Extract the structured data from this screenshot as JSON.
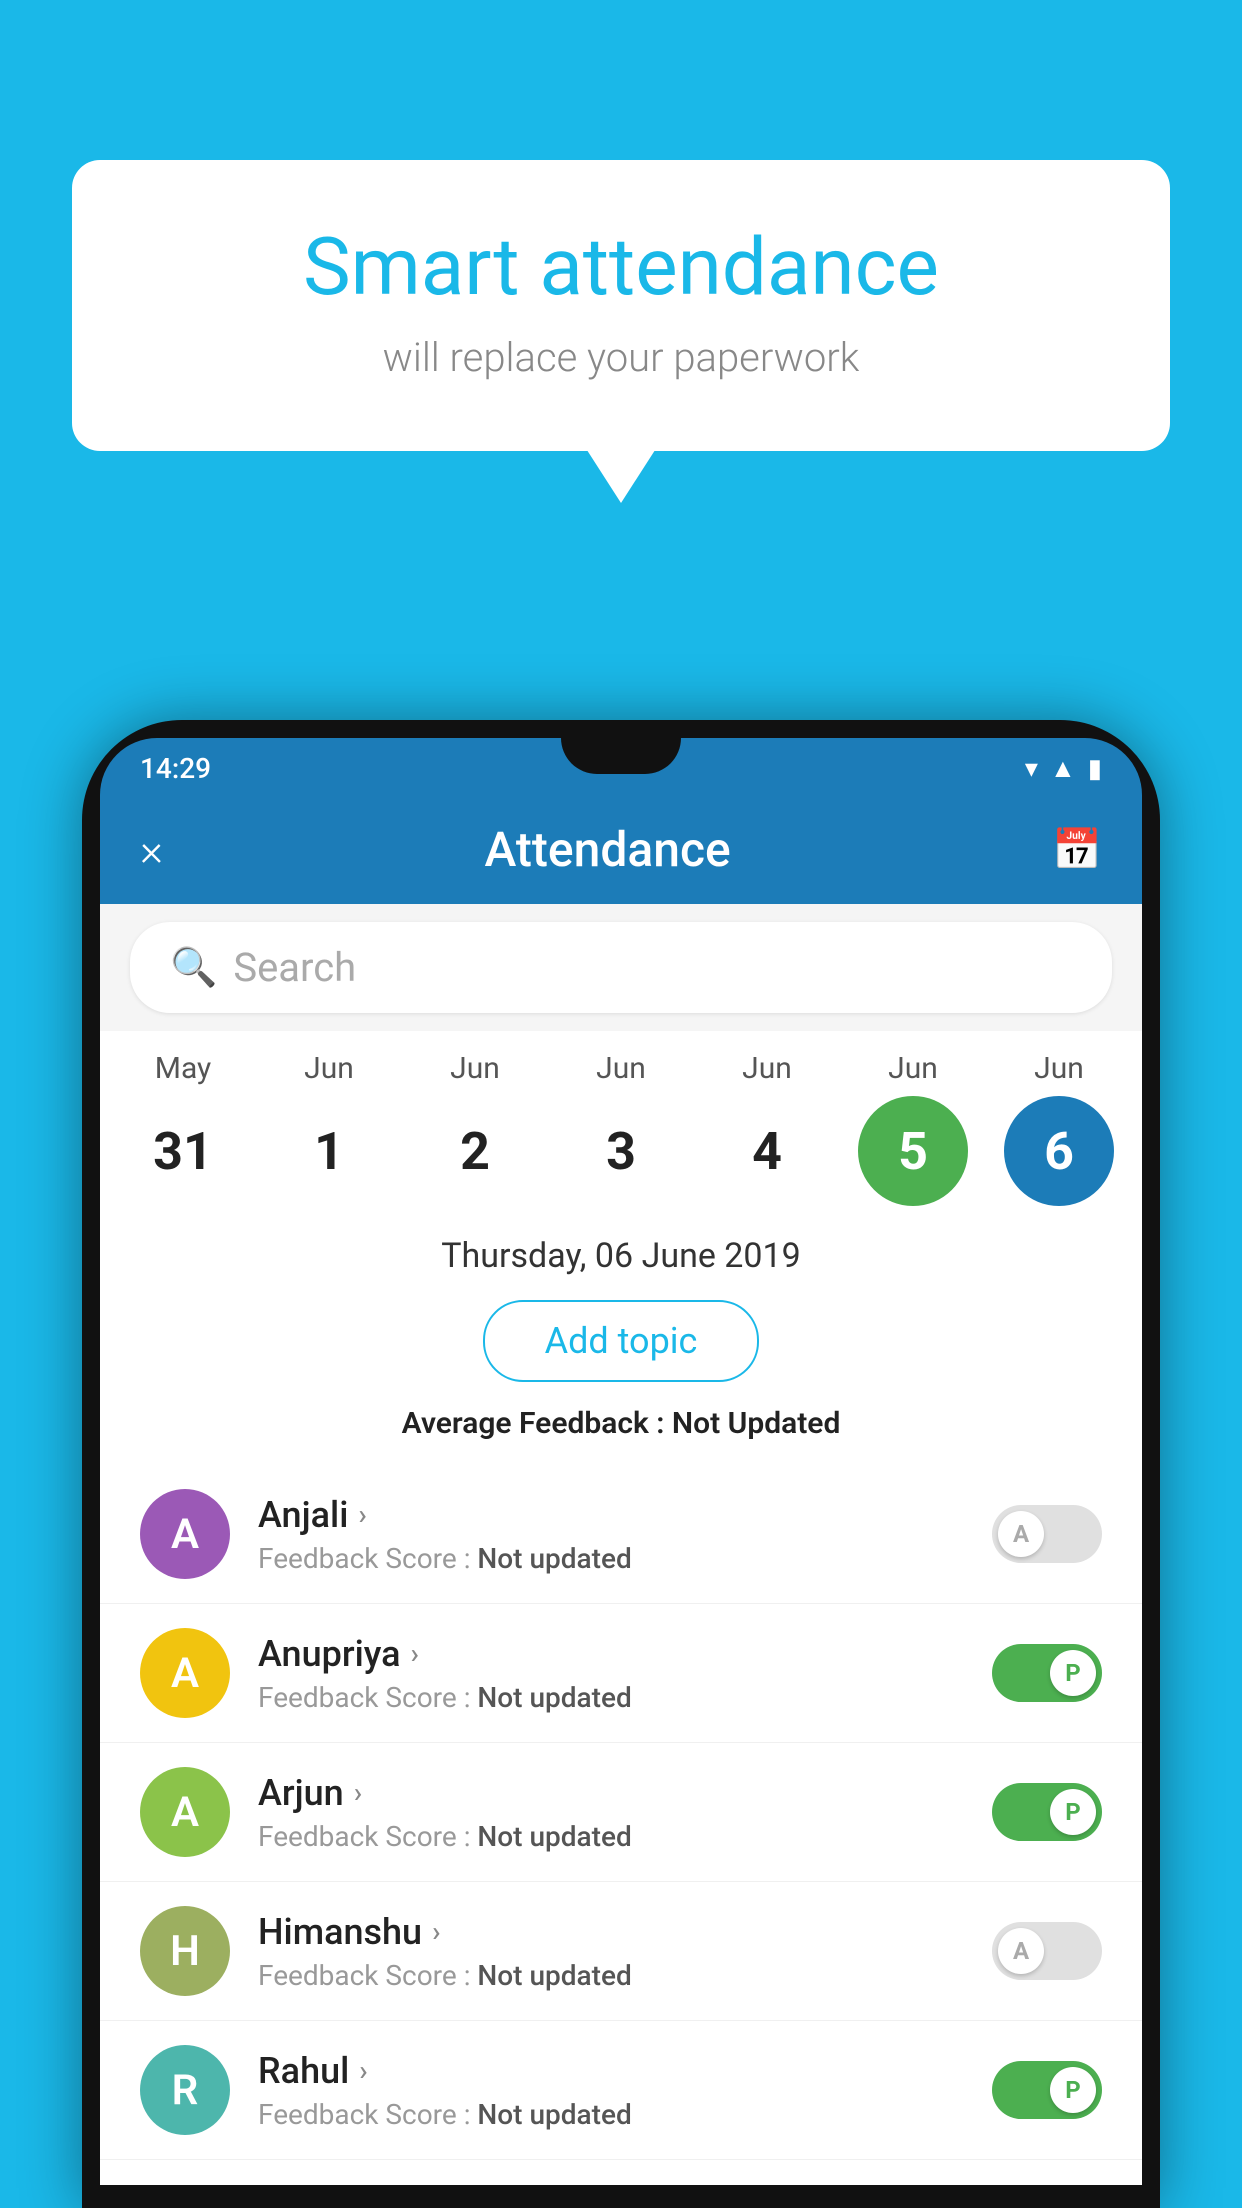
{
  "background_color": "#1ab8e8",
  "bubble": {
    "title": "Smart attendance",
    "subtitle": "will replace your paperwork"
  },
  "status_bar": {
    "time": "14:29",
    "icons": [
      "wifi",
      "signal",
      "battery"
    ]
  },
  "header": {
    "close_label": "×",
    "title": "Attendance",
    "calendar_icon": "📅"
  },
  "search": {
    "placeholder": "Search"
  },
  "dates": [
    {
      "month": "May",
      "day": "31",
      "state": "normal"
    },
    {
      "month": "Jun",
      "day": "1",
      "state": "normal"
    },
    {
      "month": "Jun",
      "day": "2",
      "state": "normal"
    },
    {
      "month": "Jun",
      "day": "3",
      "state": "normal"
    },
    {
      "month": "Jun",
      "day": "4",
      "state": "normal"
    },
    {
      "month": "Jun",
      "day": "5",
      "state": "active_green"
    },
    {
      "month": "Jun",
      "day": "6",
      "state": "active_blue"
    }
  ],
  "selected_date": "Thursday, 06 June 2019",
  "add_topic_label": "Add topic",
  "avg_feedback_label": "Average Feedback :",
  "avg_feedback_value": "Not Updated",
  "students": [
    {
      "name": "Anjali",
      "avatar_letter": "A",
      "avatar_color": "purple",
      "feedback_label": "Feedback Score :",
      "feedback_value": "Not updated",
      "toggle": "off",
      "toggle_letter": "A"
    },
    {
      "name": "Anupriya",
      "avatar_letter": "A",
      "avatar_color": "yellow",
      "feedback_label": "Feedback Score :",
      "feedback_value": "Not updated",
      "toggle": "on",
      "toggle_letter": "P"
    },
    {
      "name": "Arjun",
      "avatar_letter": "A",
      "avatar_color": "green",
      "feedback_label": "Feedback Score :",
      "feedback_value": "Not updated",
      "toggle": "on",
      "toggle_letter": "P"
    },
    {
      "name": "Himanshu",
      "avatar_letter": "H",
      "avatar_color": "olive",
      "feedback_label": "Feedback Score :",
      "feedback_value": "Not updated",
      "toggle": "off",
      "toggle_letter": "A"
    },
    {
      "name": "Rahul",
      "avatar_letter": "R",
      "avatar_color": "teal",
      "feedback_label": "Feedback Score :",
      "feedback_value": "Not updated",
      "toggle": "on",
      "toggle_letter": "P"
    }
  ]
}
